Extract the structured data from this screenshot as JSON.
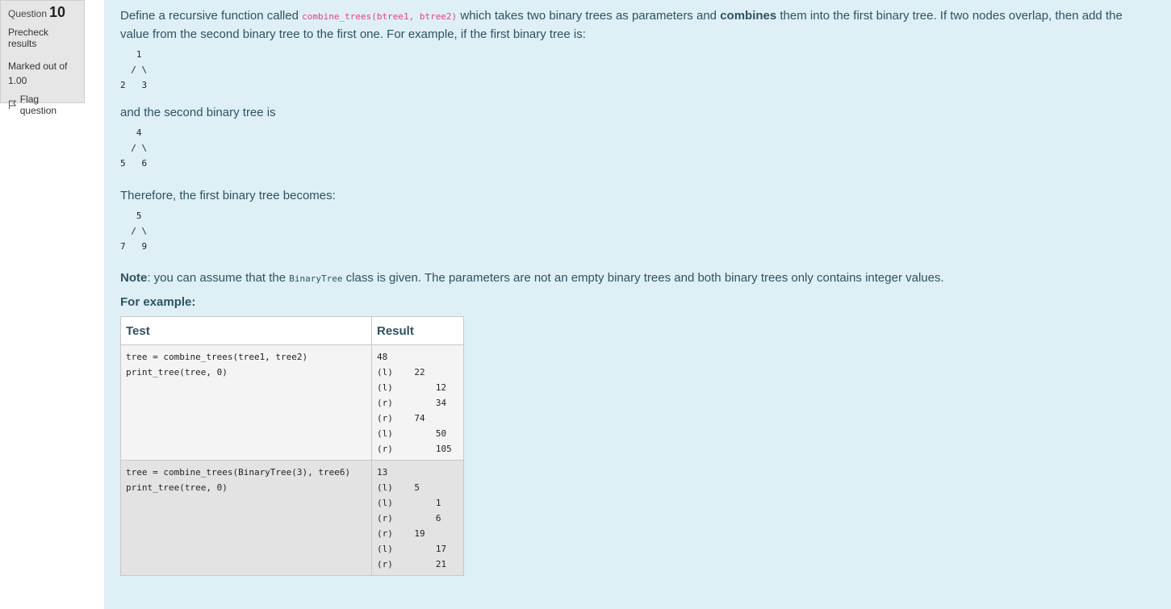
{
  "info": {
    "question_label": "Question",
    "question_number": "10",
    "state": "Precheck results",
    "grade": "Marked out of 1.00",
    "flag_label": "Flag question"
  },
  "question": {
    "intro_1": "Define a recursive function called ",
    "func_code": "combine_trees(btree1, btree2)",
    "intro_2": " which takes two binary trees as parameters and ",
    "intro_bold": "combines",
    "intro_3": " them into the first binary tree. If two nodes overlap, then add the value from the second binary tree to the first one. For example, if the first binary tree is:",
    "tree1": "   1\n  / \\\n2   3",
    "second_text": "and the second binary tree is",
    "tree2": "   4\n  / \\\n5   6",
    "therefore_text": "Therefore, the first binary tree becomes:",
    "tree3": "   5\n  / \\\n7   9",
    "note_label": "Note",
    "note_1": ": you can assume that the ",
    "note_code": "BinaryTree",
    "note_2": " class is given. The parameters are not an empty binary trees and both binary trees only contains integer values.",
    "for_example": "For example:"
  },
  "table": {
    "headers": [
      "Test",
      "Result"
    ],
    "rows": [
      {
        "test": "tree = combine_trees(tree1, tree2)\nprint_tree(tree, 0)",
        "result": "48\n(l)    22\n(l)        12\n(r)        34\n(r)    74\n(l)        50\n(r)        105"
      },
      {
        "test": "tree = combine_trees(BinaryTree(3), tree6)\nprint_tree(tree, 0)",
        "result": "13\n(l)    5\n(l)        1\n(r)        6\n(r)    19\n(l)        17\n(r)        21"
      }
    ]
  }
}
